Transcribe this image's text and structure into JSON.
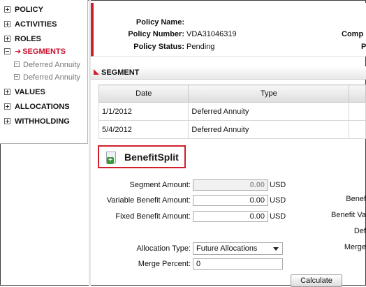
{
  "sidebar": {
    "items": [
      {
        "label": "POLICY"
      },
      {
        "label": "ACTIVITIES"
      },
      {
        "label": "ROLES"
      },
      {
        "label": "SEGMENTS"
      },
      {
        "label": "VALUES"
      },
      {
        "label": "ALLOCATIONS"
      },
      {
        "label": "WITHHOLDING"
      }
    ],
    "segment_children": [
      {
        "label": "Deferred Annuity"
      },
      {
        "label": "Deferred Annuity"
      }
    ]
  },
  "header": {
    "policy_name_label": "Policy Name:",
    "policy_name_value": "",
    "policy_number_label": "Policy Number:",
    "policy_number_value": "VDA31046319",
    "policy_status_label": "Policy Status:",
    "policy_status_value": "Pending",
    "right_label_1": "Comp",
    "right_label_2": "P"
  },
  "segment": {
    "section_title": "SEGMENT",
    "columns": [
      "Date",
      "Type",
      ""
    ],
    "rows": [
      {
        "date": "1/1/2012",
        "type": "Deferred Annuity"
      },
      {
        "date": "5/4/2012",
        "type": "Deferred Annuity"
      }
    ]
  },
  "benefit_split": {
    "title": "BenefitSplit",
    "segment_amount_label": "Segment Amount:",
    "segment_amount_value": "0.00",
    "variable_benefit_label": "Variable Benefit Amount:",
    "variable_benefit_value": "0.00",
    "fixed_benefit_label": "Fixed Benefit Amount:",
    "fixed_benefit_value": "0.00",
    "unit": "USD",
    "allocation_type_label": "Allocation Type:",
    "allocation_type_value": "Future Allocations",
    "merge_percent_label": "Merge Percent:",
    "merge_percent_value": "0",
    "calculate_label": "Calculate",
    "right_labels": [
      "Benef",
      "Benefit Va",
      "Def",
      "Merge"
    ]
  }
}
